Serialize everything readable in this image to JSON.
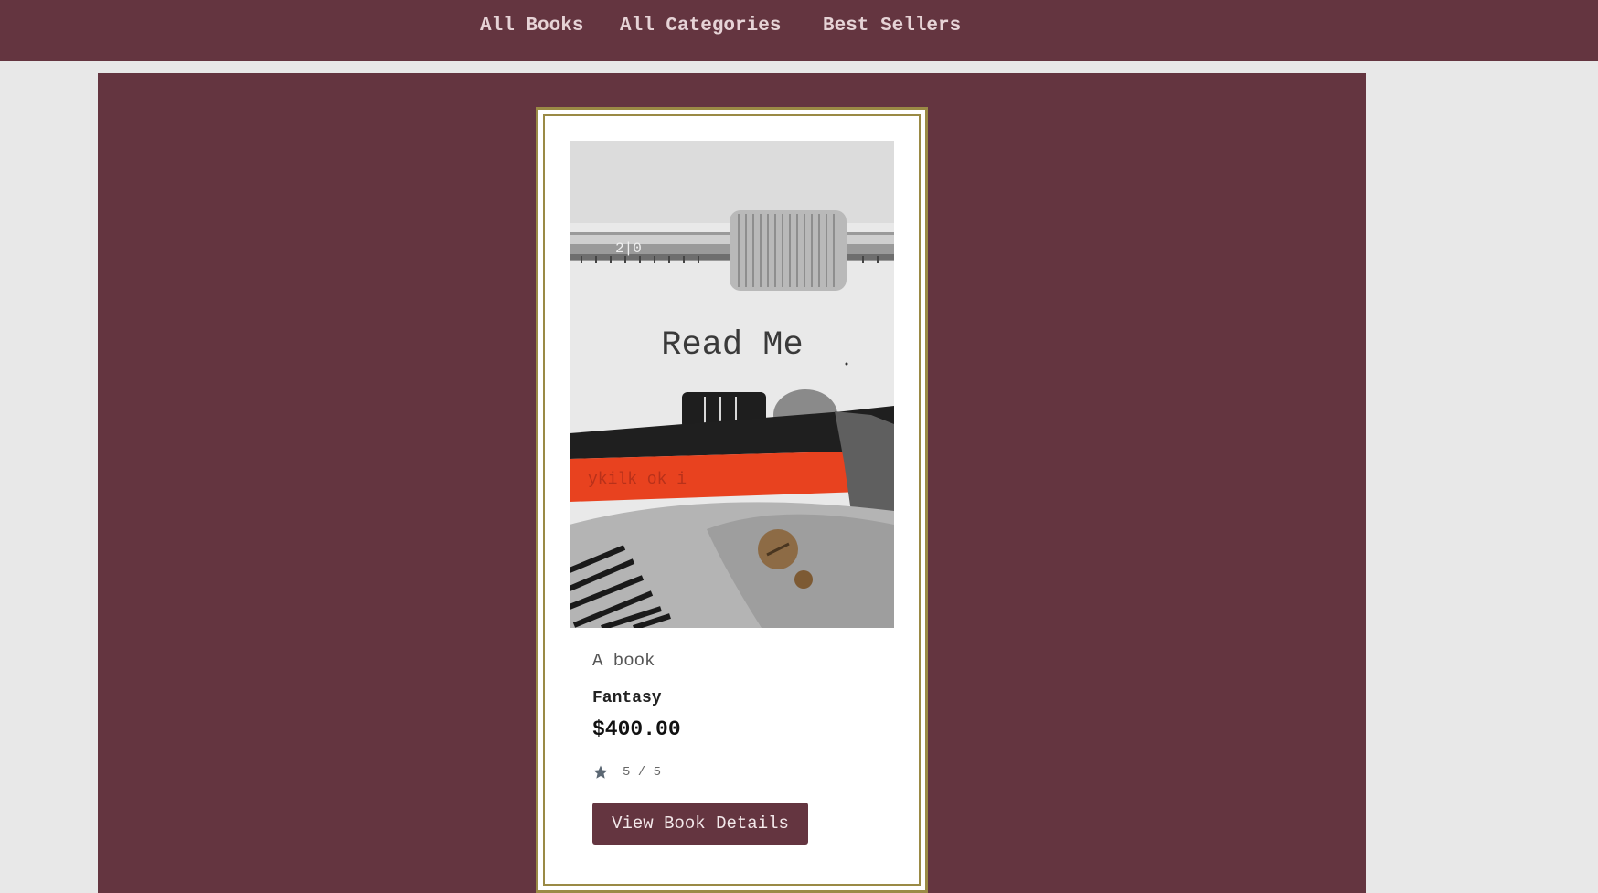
{
  "nav": {
    "items": [
      {
        "label": "All Books"
      },
      {
        "label": "All Categories"
      },
      {
        "label": "Best Sellers"
      }
    ]
  },
  "book": {
    "cover_text": "Read Me",
    "title": "A book",
    "category": "Fantasy",
    "price": "$400.00",
    "rating_text": "5 / 5",
    "button_label": "View Book Details",
    "icon": "star-icon"
  },
  "colors": {
    "brand": "#643540",
    "card_border": "#9a8a45",
    "page_bg": "#e8e8e8"
  }
}
